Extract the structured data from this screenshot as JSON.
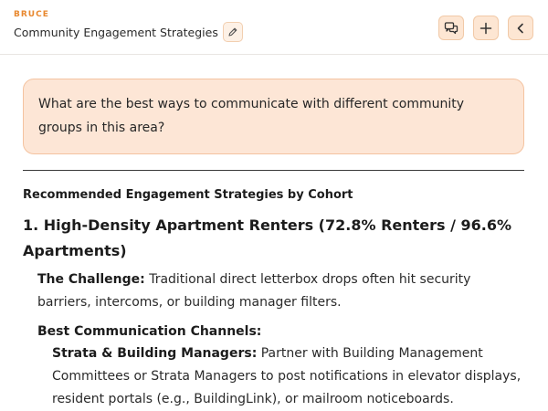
{
  "header": {
    "brand": "BRUCE",
    "title": "Community Engagement Strategies"
  },
  "icons": {
    "edit": "pencil-icon",
    "chat": "chat-bubbles-icon",
    "new": "plus-icon",
    "back": "chevron-left-icon"
  },
  "colors": {
    "accent": "#e8882f",
    "button_bg": "#fde6d3",
    "question_bg": "#fde6d6"
  },
  "question": "What are the best ways to communicate with different community groups in this area?",
  "answer": {
    "section_title": "Recommended Engagement Strategies by Cohort",
    "cohort_1": {
      "heading": "1. High-Density Apartment Renters (72.8% Renters / 96.6% Apartments)",
      "challenge_label": "The Challenge:",
      "challenge_text": " Traditional direct letterbox drops often hit security barriers, intercoms, or building manager filters.",
      "channels_label": "Best Communication Channels:",
      "channel_1_label": "Strata & Building Managers:",
      "channel_1_text": " Partner with Building Management Committees or Strata Managers to post notifications in elevator displays, resident portals (e.g., BuildingLink), or mailroom noticeboards."
    }
  }
}
